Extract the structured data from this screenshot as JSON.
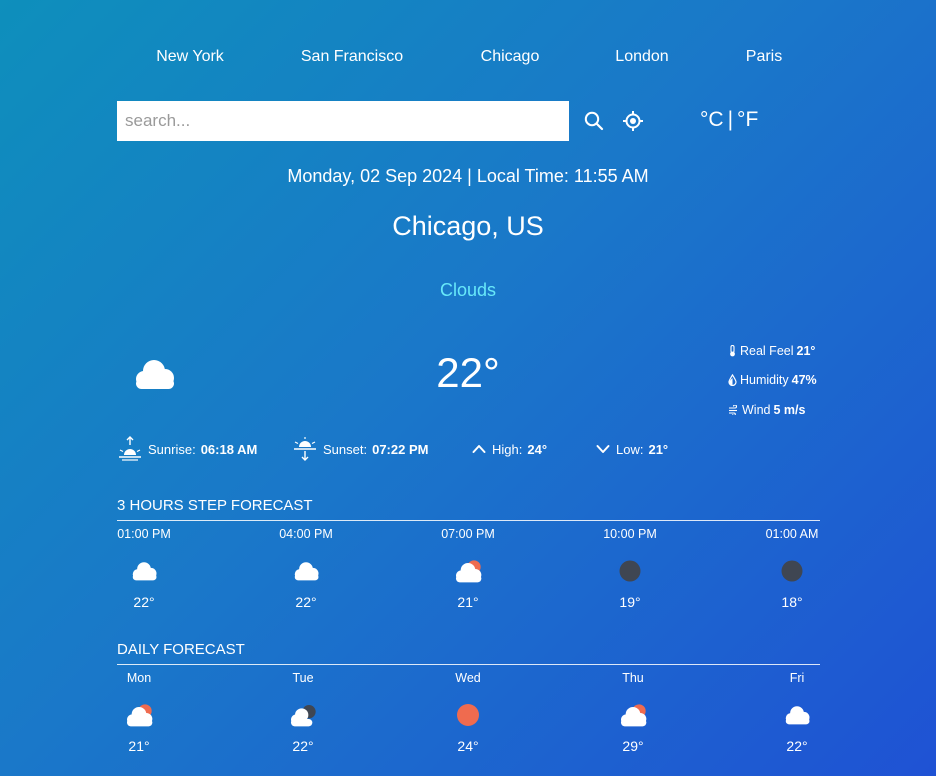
{
  "nav": {
    "cities": [
      "New York",
      "San Francisco",
      "Chicago",
      "London",
      "Paris"
    ]
  },
  "search": {
    "placeholder": "search..."
  },
  "units": {
    "celsius": "°C",
    "separator": "|",
    "fahrenheit": "°F"
  },
  "datetime": "Monday, 02 Sep 2024 | Local Time: 11:55 AM",
  "location": "Chicago, US",
  "condition": "Clouds",
  "current": {
    "temp": "22°",
    "icon": "cloud-icon",
    "real_feel_label": "Real Feel",
    "real_feel": "21°",
    "humidity_label": "Humidity",
    "humidity": "47%",
    "wind_label": "Wind",
    "wind": "5 m/s"
  },
  "sun": {
    "sunrise_label": "Sunrise:",
    "sunrise": "06:18 AM",
    "sunset_label": "Sunset:",
    "sunset": "07:22 PM",
    "high_label": "High:",
    "high": "24°",
    "low_label": "Low:",
    "low": "21°"
  },
  "hourly": {
    "title": "3 HOURS STEP FORECAST",
    "items": [
      {
        "label": "01:00 PM",
        "icon": "cloud-icon",
        "temp": "22°"
      },
      {
        "label": "04:00 PM",
        "icon": "cloud-icon",
        "temp": "22°"
      },
      {
        "label": "07:00 PM",
        "icon": "cloud-sun-icon",
        "temp": "21°"
      },
      {
        "label": "10:00 PM",
        "icon": "night-moon-icon",
        "temp": "19°"
      },
      {
        "label": "01:00 AM",
        "icon": "night-moon-icon",
        "temp": "18°"
      }
    ]
  },
  "daily": {
    "title": "DAILY FORECAST",
    "items": [
      {
        "label": "Mon",
        "icon": "cloud-sun-icon",
        "temp": "21°"
      },
      {
        "label": "Tue",
        "icon": "cloud-moon-icon",
        "temp": "22°"
      },
      {
        "label": "Wed",
        "icon": "sun-icon",
        "temp": "24°"
      },
      {
        "label": "Thu",
        "icon": "cloud-sun-icon",
        "temp": "29°"
      },
      {
        "label": "Fri",
        "icon": "cloud-icon",
        "temp": "22°"
      }
    ]
  },
  "colors": {
    "accent_condition": "#67e8f9",
    "sun": "#ef6b4f",
    "moon": "#3f4652"
  }
}
